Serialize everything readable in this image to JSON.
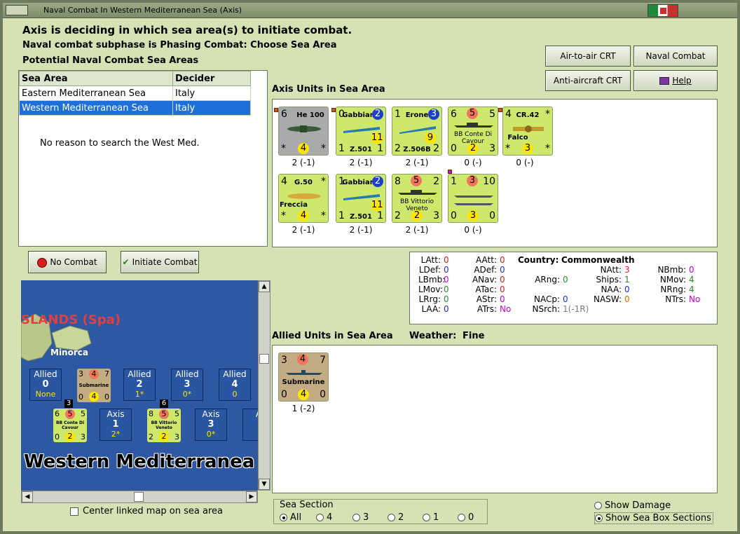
{
  "window": {
    "title": "Naval Combat In Western Mediterranean Sea (Axis)"
  },
  "header": {
    "line1": "Axis is deciding in which sea area(s) to initiate combat.",
    "line2": "Naval combat subphase is Phasing Combat: Choose Sea Area",
    "line3": "Potential Naval Combat Sea Areas"
  },
  "buttons": {
    "air_to_air": "Air-to-air CRT",
    "naval_chart": "Naval Combat Chart",
    "anti_aircraft": "Anti-aircraft CRT",
    "help": "Help",
    "no_combat": "No Combat",
    "initiate": "Initiate Combat"
  },
  "sea_table": {
    "headers": [
      "Sea Area",
      "Decider"
    ],
    "rows": [
      {
        "area": "Eastern Mediterranean Sea",
        "decider": "Italy"
      },
      {
        "area": "Western Mediterranean Sea",
        "decider": "Italy"
      }
    ],
    "message": "No reason to search the West Med."
  },
  "axis_label": "Axis Units in Sea Area",
  "axis_units": [
    {
      "tl": "6",
      "name": "He 100",
      "bl": "*",
      "br": "*",
      "midb": "4",
      "label": "2 (-1)"
    },
    {
      "tl": "0",
      "name": "Gabbiano",
      "tr_circle": "2",
      "mid": "11",
      "bl": "1",
      "sub": "Z.501",
      "br": "1",
      "label": "2 (-1)"
    },
    {
      "tl": "1",
      "name": "Erone",
      "tr_circle": "3",
      "mid": "9",
      "bl": "2",
      "sub": "Z.506B",
      "br": "2",
      "label": "2 (-1)"
    },
    {
      "tl": "6",
      "top_circle": "5",
      "tr": "5",
      "name": "BB Conte Di Cavour",
      "bl": "0",
      "midb": "2",
      "br": "3",
      "label": "0 (-)"
    },
    {
      "tl": "4",
      "name": "CR.42",
      "tr": "*",
      "sub": "Falco",
      "bl": "*",
      "midb": "3",
      "br": "*",
      "label": "0 (-)"
    },
    {
      "tl": "4",
      "name": "G.50",
      "tr": "*",
      "sub": "Freccia",
      "bl": "*",
      "midb": "4",
      "br": "*",
      "label": "2 (-1)"
    },
    {
      "tl": "1",
      "name": "Gabbiano",
      "tr_circle": "2",
      "mid": "11",
      "bl": "1",
      "sub": "Z.501",
      "br": "1",
      "label": "2 (-1)"
    },
    {
      "tl": "8",
      "top_circle": "5",
      "tr": "2",
      "name": "BB Vittorio Veneto",
      "bl": "2",
      "midb": "2",
      "br": "3",
      "label": "2 (-1)"
    },
    {
      "tl": "1",
      "top_circle": "3",
      "tr": "10",
      "bl": "0",
      "midb": "3",
      "br": "0",
      "label": "0 (-)"
    }
  ],
  "stats": {
    "country_label": "Country:",
    "country": "Commonwealth",
    "col1": [
      [
        "LAtt:",
        "0"
      ],
      [
        "LDef:",
        "0"
      ],
      [
        "LBmb:",
        "0"
      ],
      [
        "LMov:",
        "0"
      ],
      [
        "LRrg:",
        "0"
      ],
      [
        "LAA:",
        "0"
      ]
    ],
    "col2": [
      [
        "AAtt:",
        "0"
      ],
      [
        "ADef:",
        "0"
      ],
      [
        "ANav:",
        "0"
      ],
      [
        "ATac:",
        "0"
      ],
      [
        "AStr:",
        "0"
      ],
      [
        "ATrs:",
        "No"
      ]
    ],
    "col3": [
      [
        "ARng:",
        "0"
      ],
      [
        "NACp:",
        "0"
      ],
      [
        "NSrch:",
        "1(-1R)"
      ]
    ],
    "col4": [
      [
        "NAtt:",
        "3"
      ],
      [
        "Ships:",
        "1"
      ],
      [
        "NAA:",
        "0"
      ],
      [
        "NASW:",
        "0"
      ]
    ],
    "col5": [
      [
        "NBmb:",
        "0"
      ],
      [
        "NMov:",
        "4"
      ],
      [
        "NRng:",
        "4"
      ],
      [
        "NTrs:",
        "No"
      ]
    ]
  },
  "allied_label": "Allied Units in Sea Area",
  "weather_label": "Weather:",
  "weather": "Fine",
  "allied_unit": {
    "tl": "3",
    "top_circle": "4",
    "tr": "7",
    "name": "Submarine",
    "bl": "0",
    "midb": "4",
    "br": "0",
    "label": "1 (-2)"
  },
  "map": {
    "islands_label": "SLANDS (Spa)",
    "minorca": "Minorca",
    "sea_name": "Western Mediterranea",
    "allied_boxes": [
      {
        "title": "Allied",
        "num": "0",
        "sub": "None"
      },
      {
        "title": "Allied",
        "num": "2",
        "sub": "1*"
      },
      {
        "title": "Allied",
        "num": "3",
        "sub": "0*"
      },
      {
        "title": "Allied",
        "num": "4",
        "sub": "0"
      }
    ],
    "axis_boxes": [
      {
        "title": "Axis",
        "num": "1",
        "sub": "2*"
      },
      {
        "title": "Axis",
        "num": "3",
        "sub": "0*"
      }
    ],
    "partial_box": "A",
    "sub_counter": {
      "tl": "3",
      "top": "4",
      "tr": "7",
      "name": "Submarine",
      "bl": "0",
      "mid": "4",
      "br": "0"
    },
    "conte": {
      "stack": "3",
      "tl": "6",
      "top": "5",
      "tr": "5",
      "name": "BB Conte Di Cavour",
      "bl": "0",
      "mid": "2",
      "br": "3"
    },
    "vittorio": {
      "stack": "6",
      "tl": "8",
      "top": "5",
      "tr": "5",
      "name": "BB Vittorio Veneto",
      "bl": "2",
      "mid": "2",
      "br": "3"
    }
  },
  "center_map": "Center linked map on sea area",
  "sea_section": {
    "title": "Sea Section",
    "options": [
      "All",
      "4",
      "3",
      "2",
      "1",
      "0"
    ],
    "selected": "All"
  },
  "show_damage": "Show Damage",
  "show_sections": "Show Sea Box Sections"
}
